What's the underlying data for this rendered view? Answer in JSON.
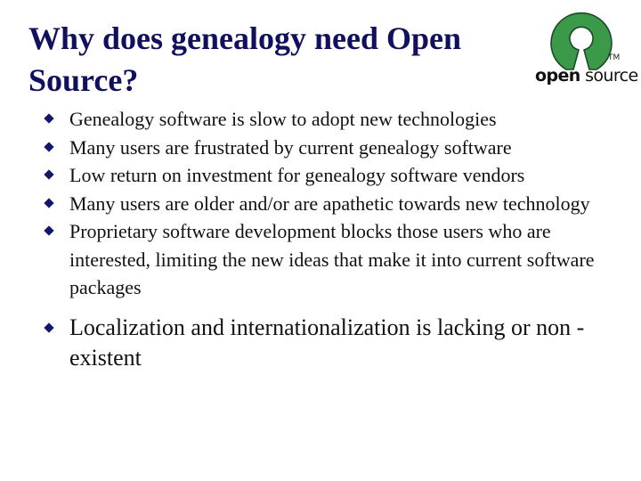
{
  "slide": {
    "title": "Why does genealogy need Open Source?",
    "logo": {
      "icon": "open-source-keyhole-logo",
      "wordmark_bold": "open",
      "wordmark_rest": " source",
      "trademark": "TM",
      "color": "#3a9a4a"
    },
    "bullet_color": "#15156a",
    "title_color": "#10105e",
    "bullets": [
      {
        "text": "Genealogy software is slow to adopt new technologies"
      },
      {
        "text": "Many users are frustrated by current genealogy software"
      },
      {
        "text": "Low return on investment for genealogy software vendors"
      },
      {
        "text": "Many users are older and/or are apathetic towards new technology"
      },
      {
        "text": "Proprietary software development blocks those users who are interested, limiting the new ideas that make it into current software packages"
      },
      {
        "text": "Localization and internationalization is lacking or non -existent"
      }
    ]
  }
}
